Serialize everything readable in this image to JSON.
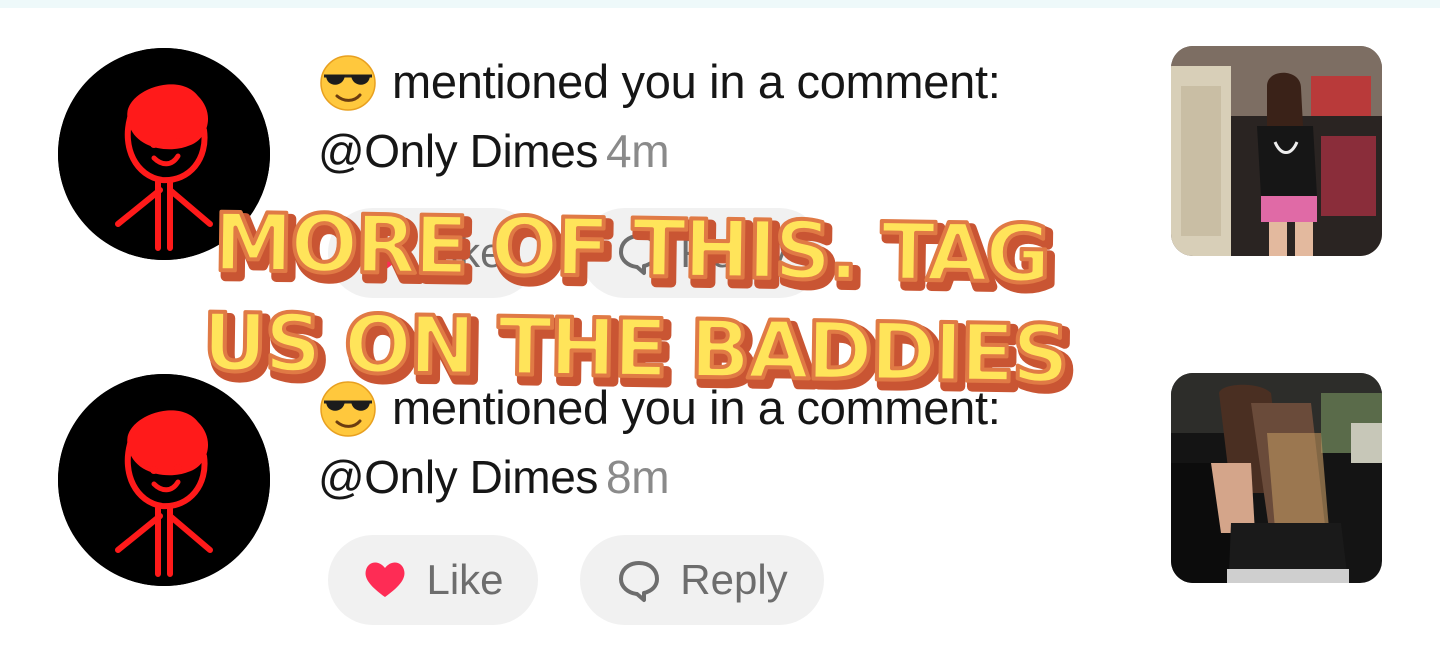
{
  "notifications": [
    {
      "action_text": "mentioned you in a comment:",
      "handle": "@Only Dimes",
      "time": "4m",
      "like_label": "Like",
      "reply_label": "Reply"
    },
    {
      "action_text": "mentioned you in a comment:",
      "handle": "@Only Dimes",
      "time": "8m",
      "like_label": "Like",
      "reply_label": "Reply"
    }
  ],
  "overlay_caption": {
    "line1": "MORE OF THIS. TAG",
    "line2": "US ON THE BADDIES"
  },
  "icons": {
    "avatar": "stick-figure-avatar",
    "emoji": "sunglasses-emoji",
    "like": "heart-icon",
    "reply": "speech-bubble-icon"
  },
  "colors": {
    "heart": "#fe2c55",
    "caption_fill": "#ffe45a",
    "caption_stroke": "#d9613a",
    "muted_text": "#8a8a8a",
    "pill_bg": "#f1f1f1"
  }
}
